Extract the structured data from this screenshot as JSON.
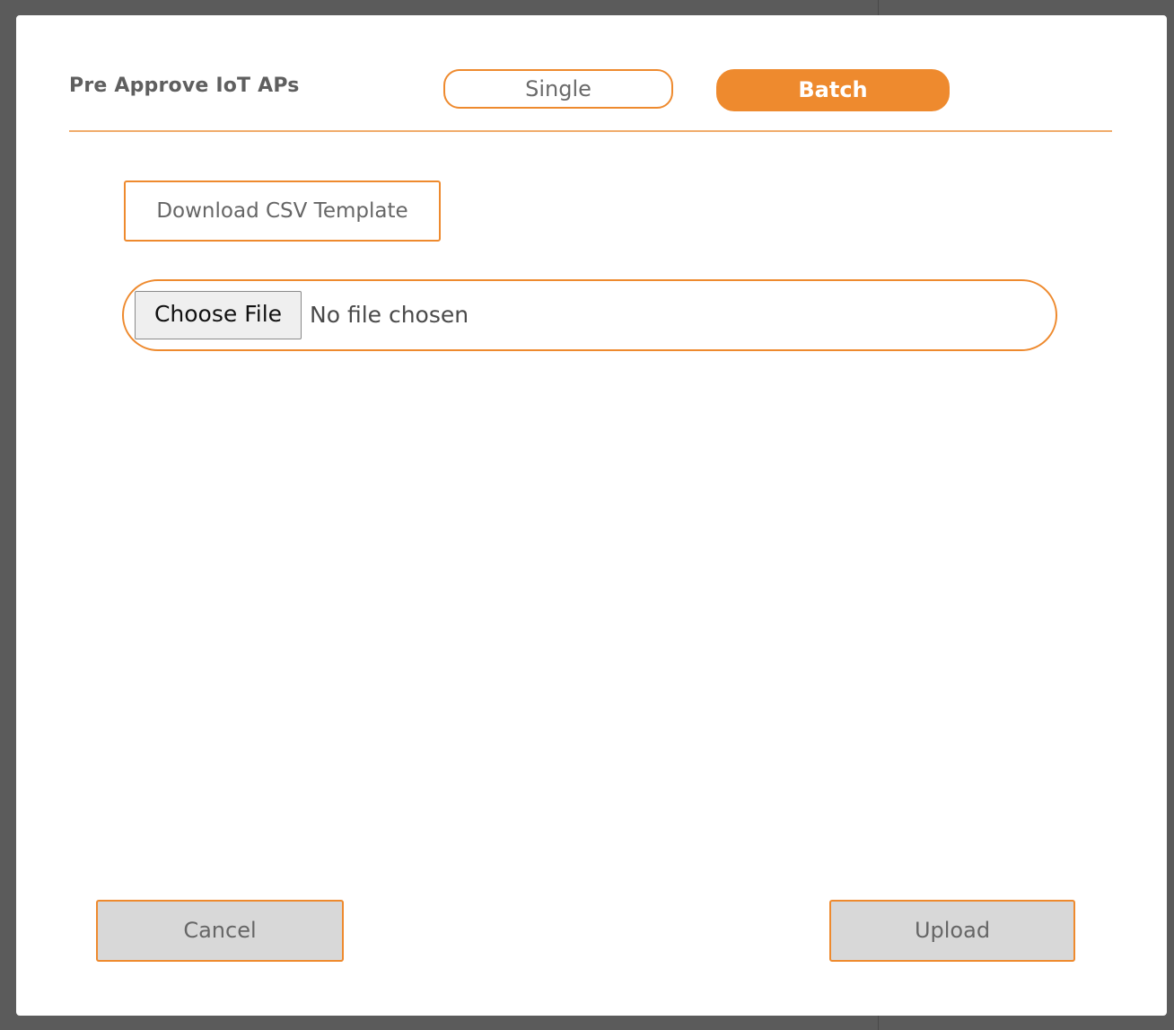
{
  "modal": {
    "title": "Pre Approve IoT APs",
    "toggle": {
      "single_label": "Single",
      "batch_label": "Batch",
      "selected": "Batch"
    },
    "download_template_label": "Download CSV Template",
    "file_input": {
      "button_label": "Choose File",
      "status_text": "No file chosen"
    },
    "footer": {
      "cancel_label": "Cancel",
      "upload_label": "Upload"
    }
  },
  "colors": {
    "accent": "#ee8a2e",
    "button_disabled_bg": "#d8d8d8",
    "overlay": "#5b5b5b"
  }
}
